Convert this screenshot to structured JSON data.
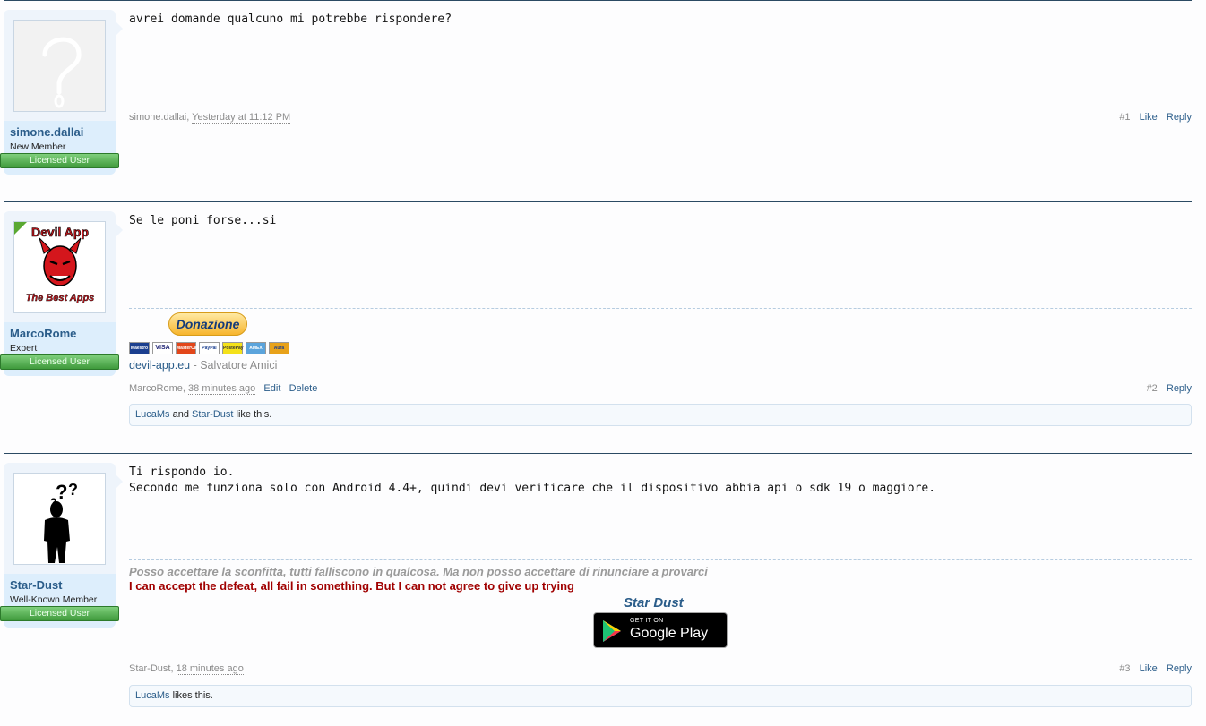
{
  "posts": [
    {
      "username": "simone.dallai",
      "user_title": "New Member",
      "badge": "Licensed User",
      "message_lines": [
        "avrei domande qualcuno mi potrebbe rispondere?"
      ],
      "author": "simone.dallai",
      "date": "Yesterday at 11:12 PM",
      "number": "#1",
      "like": "Like",
      "reply": "Reply"
    },
    {
      "username": "MarcoRome",
      "user_title": "Expert",
      "badge": "Licensed User",
      "avatar_text_top": "Devil App",
      "avatar_text_bottom": "The Best Apps",
      "message_lines": [
        "Se le poni forse...si"
      ],
      "donate_label": "Donazione",
      "site": "devil-app.eu",
      "owner": " - Salvatore Amici",
      "author": "MarcoRome",
      "date": "38 minutes ago",
      "edit": "Edit",
      "delete": "Delete",
      "number": "#2",
      "reply": "Reply",
      "likes": {
        "user1": "LucaMs",
        "and": " and ",
        "user2": "Star-Dust",
        "suffix": " like this."
      }
    },
    {
      "username": "Star-Dust",
      "user_title": "Well-Known Member",
      "badge": "Licensed User",
      "message_lines": [
        "Ti rispondo io.",
        "Secondo me funziona solo con Android 4.4+, quindi devi verificare che il dispositivo abbia api o sdk 19 o maggiore."
      ],
      "quote_it": "Posso accettare la sconfitta, tutti falliscono in qualcosa. Ma non posso accettare di rinunciare a provarci",
      "quote_en": "I can accept the defeat, all fail in something. But I can not agree to give up trying",
      "sig_name": "Star Dust",
      "gplay_small": "GET IT ON",
      "gplay_big": "Google Play",
      "author": "Star-Dust",
      "date": "18 minutes ago",
      "number": "#3",
      "like": "Like",
      "reply": "Reply",
      "likes": {
        "user1": "LucaMs",
        "suffix": " likes this."
      }
    }
  ],
  "cards": [
    "Maestro",
    "VISA",
    "MasterCard",
    "PayPal",
    "PostePay",
    "AMEX",
    "Aura"
  ],
  "colors": {
    "link": "#2b5d8a",
    "badge": "#3f9a3c",
    "quote_en": "#a00000"
  }
}
